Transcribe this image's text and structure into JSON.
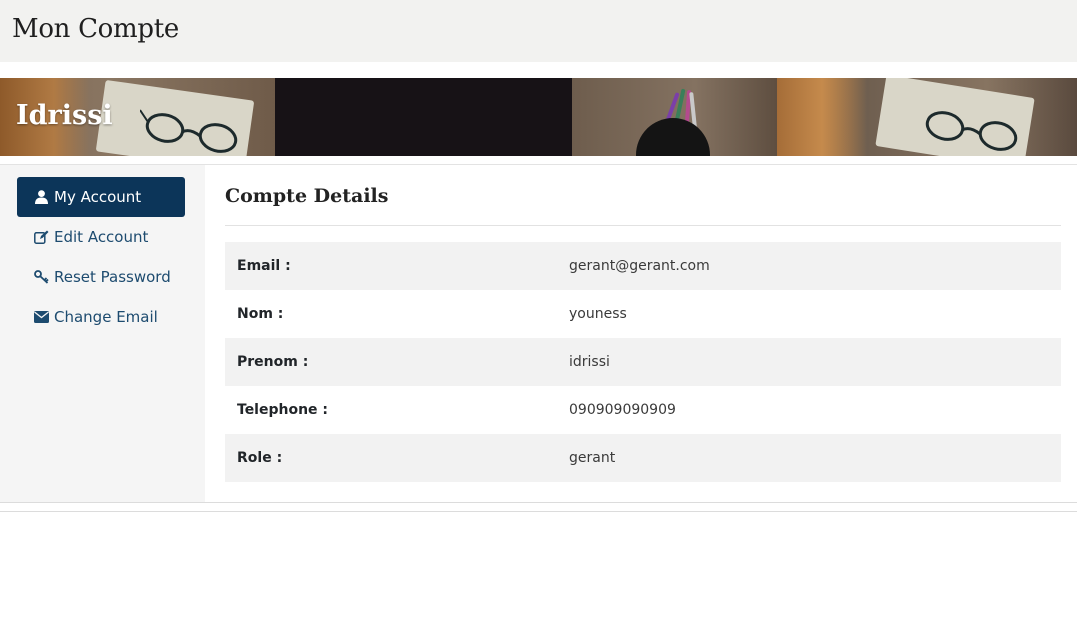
{
  "page": {
    "title": "Mon Compte"
  },
  "banner": {
    "name": "Idrissi"
  },
  "sidebar": {
    "items": [
      {
        "label": "My Account",
        "icon": "user-icon",
        "active": true
      },
      {
        "label": "Edit Account",
        "icon": "edit-icon",
        "active": false
      },
      {
        "label": "Reset Password",
        "icon": "key-icon",
        "active": false
      },
      {
        "label": "Change Email",
        "icon": "envelope-icon",
        "active": false
      }
    ]
  },
  "details": {
    "title": "Compte Details",
    "rows": [
      {
        "key": "Email :",
        "value": "gerant@gerant.com"
      },
      {
        "key": "Nom :",
        "value": "youness"
      },
      {
        "key": "Prenom :",
        "value": "idrissi"
      },
      {
        "key": "Telephone :",
        "value": "090909090909"
      },
      {
        "key": "Role :",
        "value": "gerant"
      }
    ]
  },
  "colors": {
    "accent": "#0c3559",
    "link": "#1d4b6f",
    "header_bg": "#f2f2f0",
    "sidebar_bg": "#f5f5f5",
    "row_shade": "#f2f2f2"
  }
}
